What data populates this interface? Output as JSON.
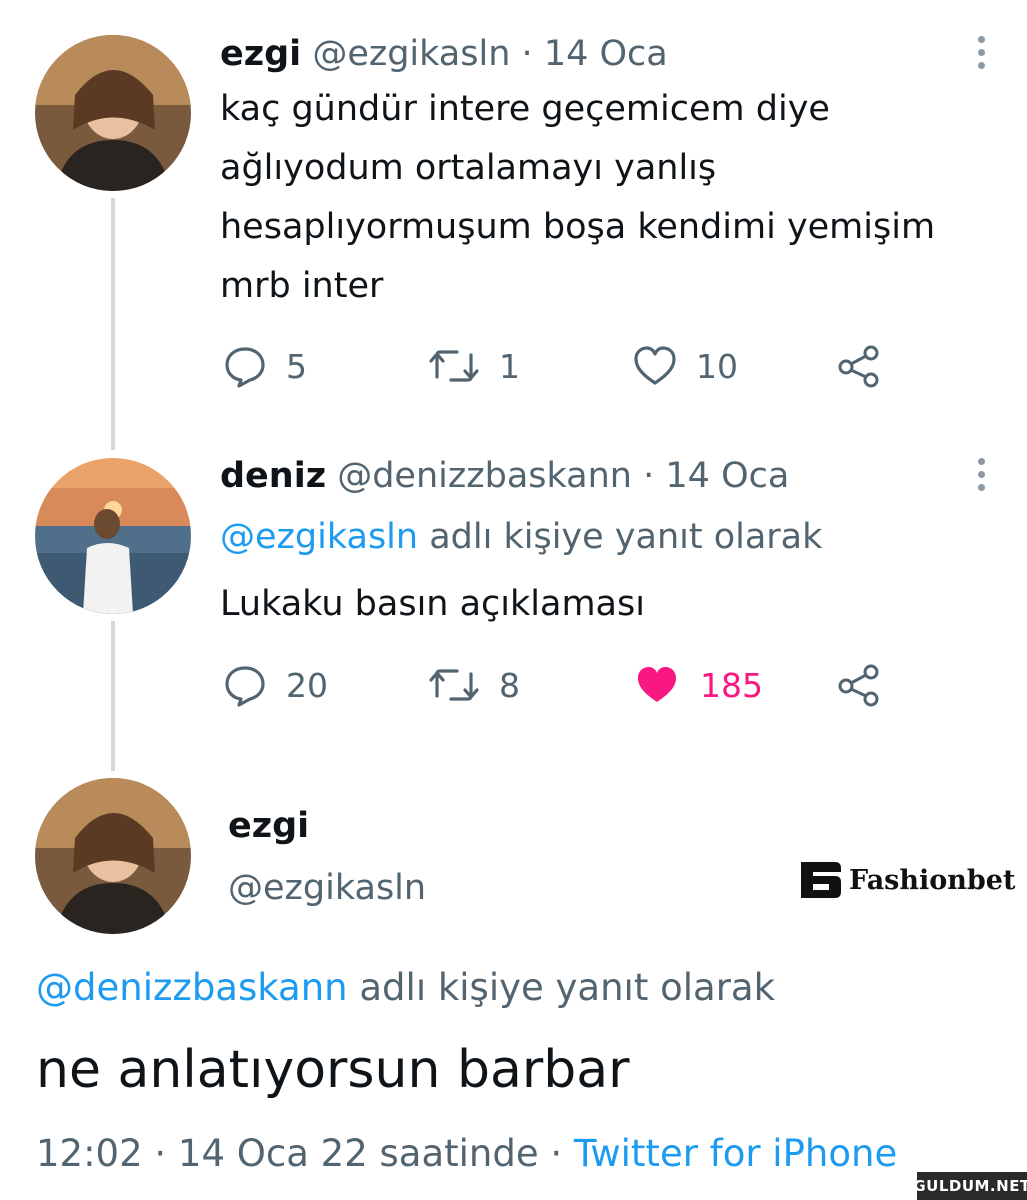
{
  "tweet1": {
    "name": "ezgi",
    "handle": "@ezgikasln",
    "date": "14 Oca",
    "text_lines": [
      "kaç gündür intere geçemicem diye",
      "ağlıyodum ortalamayı yanlış",
      "hesaplıyormuşum boşa kendimi yemişim",
      "mrb inter"
    ],
    "replies": "5",
    "retweets": "1",
    "likes": "10"
  },
  "tweet2": {
    "name": "deniz",
    "handle": "@denizzbaskann",
    "date": "14 Oca",
    "reply_to_handle": "@ezgikasln",
    "reply_to_suffix": "adlı kişiye yanıt olarak",
    "text": "Lukaku basın açıklaması",
    "replies": "20",
    "retweets": "8",
    "likes": "185",
    "liked_color": "#f91880"
  },
  "main_tweet": {
    "name": "ezgi",
    "handle": "@ezgikasln",
    "reply_to_handle": "@denizzbaskann",
    "reply_to_suffix": "adlı kişiye yanıt olarak",
    "text": "ne anlatıyorsun barbar",
    "time": "12:02 · 14 Oca 22 saatinde",
    "source": "Twitter for iPhone"
  },
  "watermark": {
    "brand": "Fashionbet",
    "site": "GULDUM.NET"
  },
  "colors": {
    "link": "#1d9bf0",
    "muted": "#536471",
    "like": "#f91880"
  },
  "icons": [
    "more-icon",
    "reply-icon",
    "retweet-icon",
    "like-icon",
    "share-icon"
  ]
}
